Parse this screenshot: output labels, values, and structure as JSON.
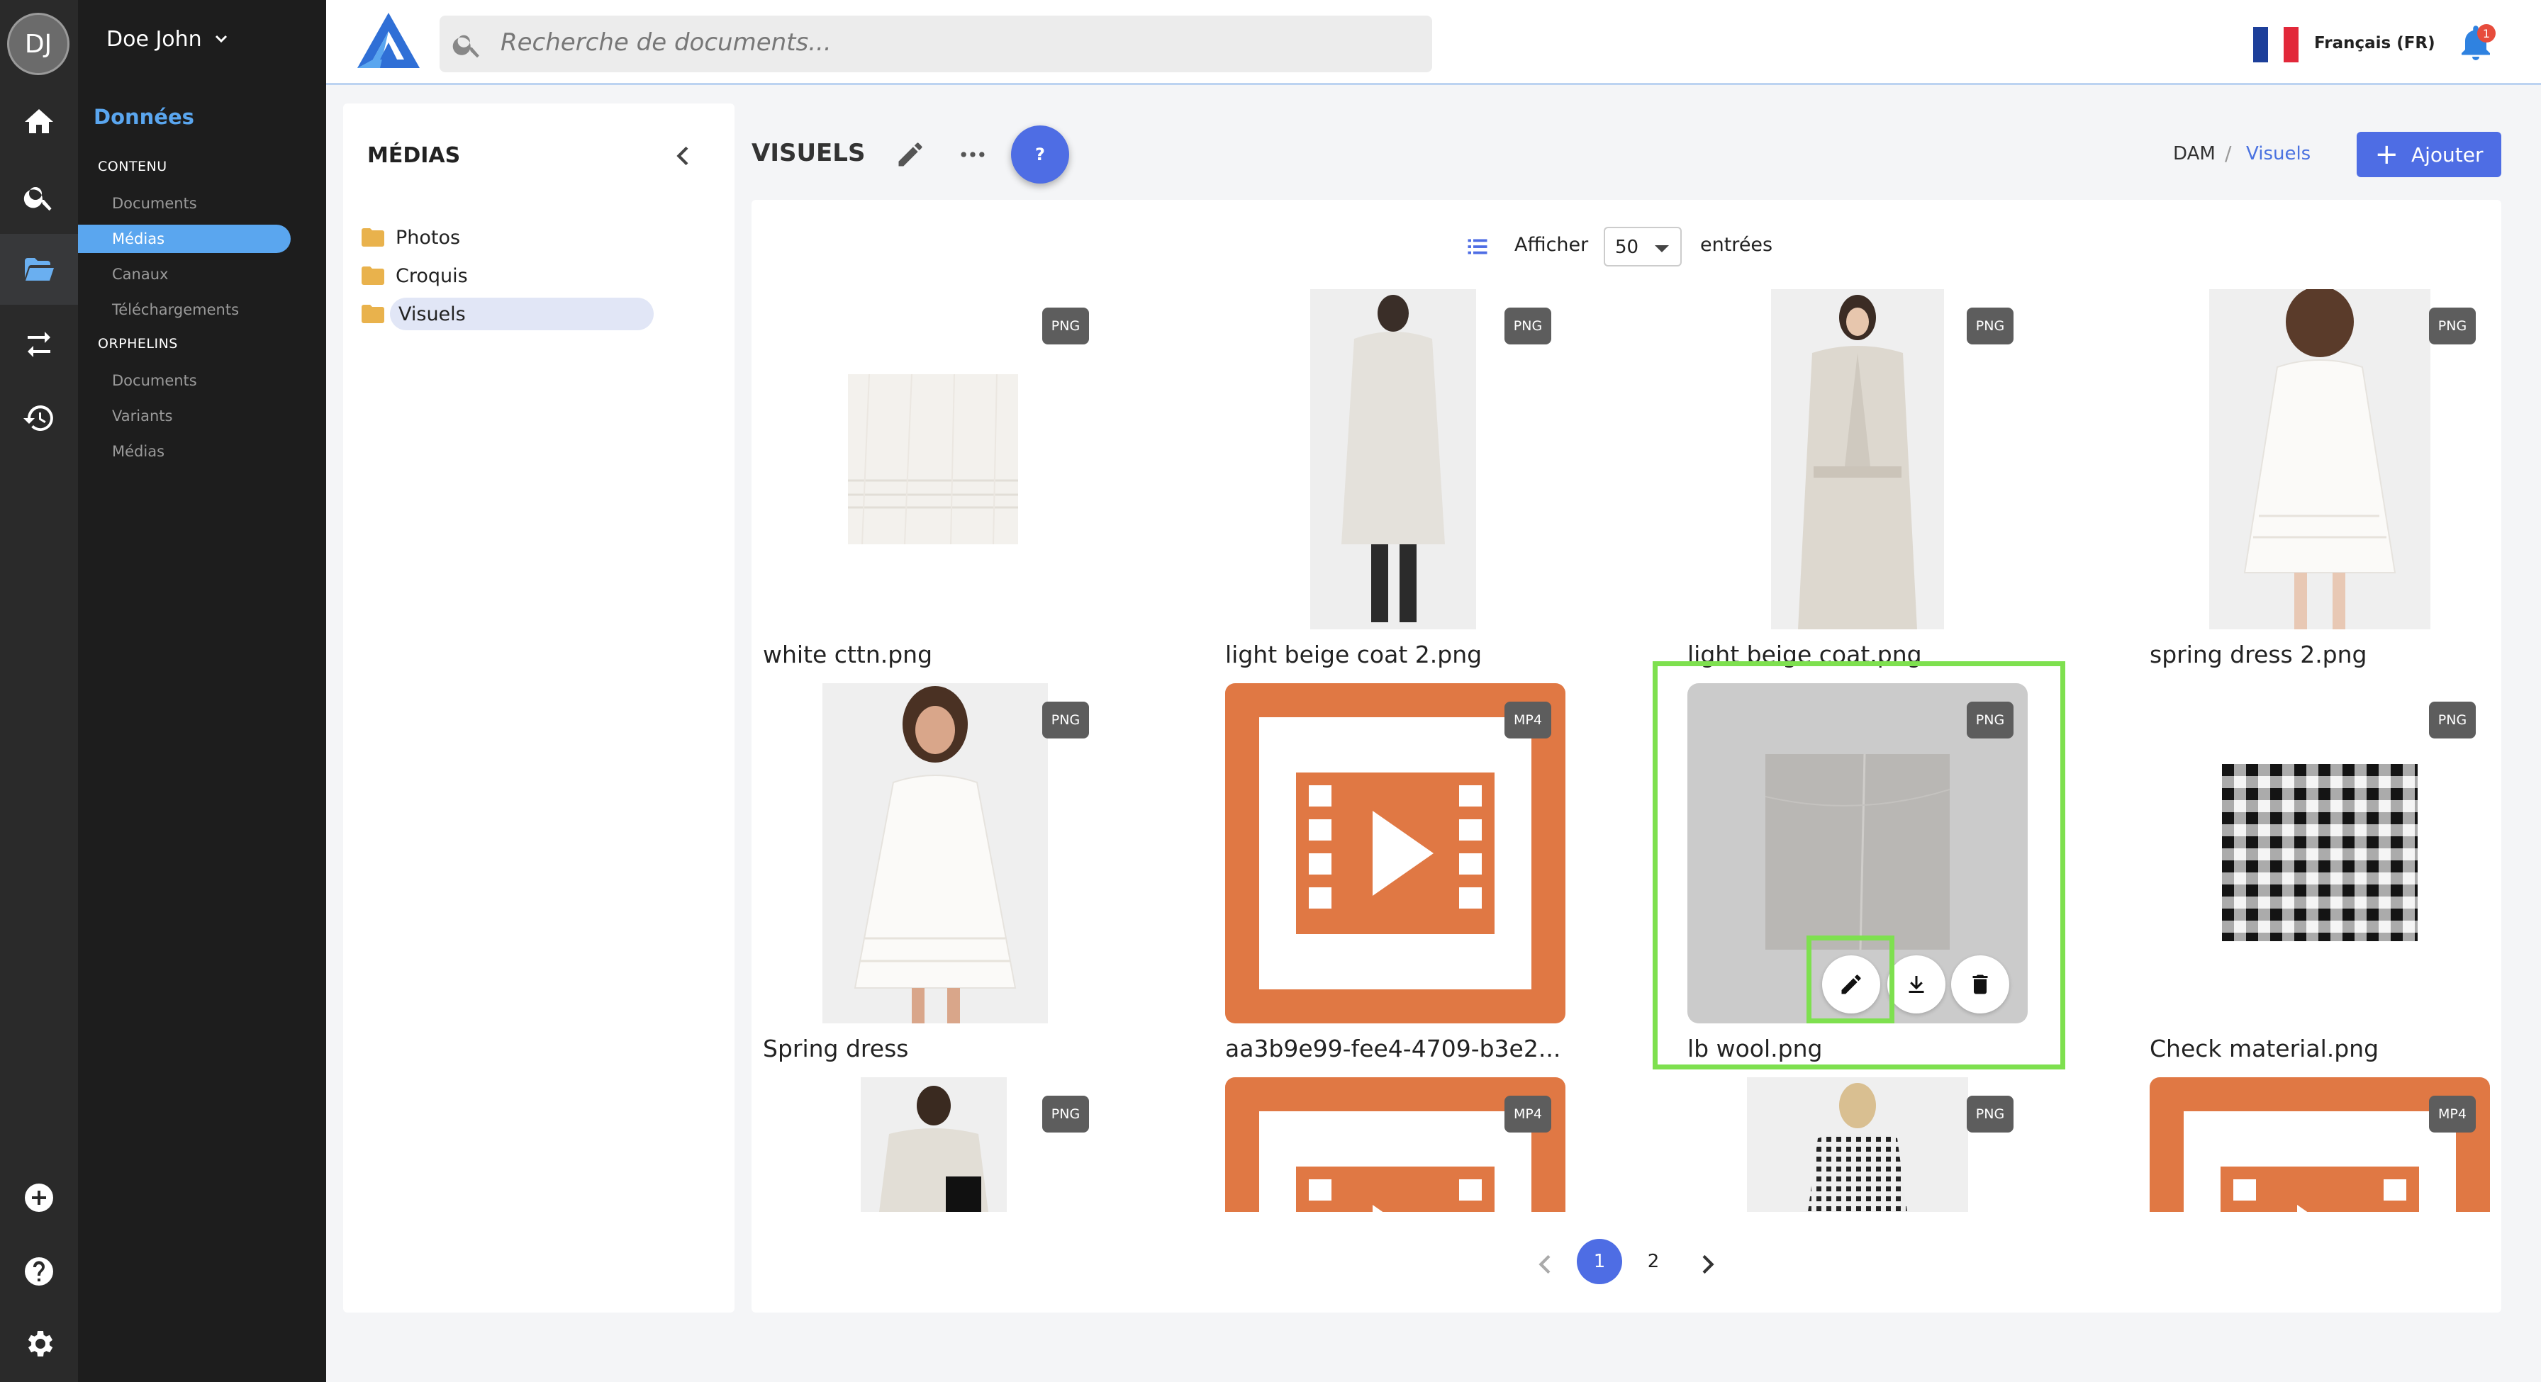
{
  "user": {
    "initials": "DJ",
    "name": "Doe John"
  },
  "nav": {
    "title": "Données",
    "sections": [
      {
        "label": "CONTENU",
        "items": [
          "Documents",
          "Médias",
          "Canaux",
          "Téléchargements"
        ]
      },
      {
        "label": "ORPHELINS",
        "items": [
          "Documents",
          "Variants",
          "Médias"
        ]
      }
    ],
    "selected": "Médias"
  },
  "rail_icons": [
    "home-icon",
    "search-icon",
    "folder-open-icon",
    "transfer-icon",
    "history-icon",
    "add-circle-icon",
    "help-icon",
    "settings-icon"
  ],
  "search": {
    "placeholder": "Recherche de documents..."
  },
  "language": {
    "label": "Français (FR)"
  },
  "notifications": {
    "count": "1"
  },
  "folders_panel": {
    "title": "MÉDIAS",
    "folders": [
      "Photos",
      "Croquis",
      "Visuels"
    ],
    "selected": "Visuels"
  },
  "content": {
    "title": "VISUELS",
    "help_label": "?",
    "breadcrumb": {
      "root": "DAM",
      "separator": "/",
      "current": "Visuels"
    },
    "add_button": "Ajouter",
    "show_label": "Afficher",
    "page_size": "50",
    "entries_label": "entrées"
  },
  "media_items": [
    {
      "name": "white cttn.png",
      "type": "PNG"
    },
    {
      "name": "light beige coat 2.png",
      "type": "PNG"
    },
    {
      "name": "light beige coat.png",
      "type": "PNG"
    },
    {
      "name": "spring dress 2.png",
      "type": "PNG"
    },
    {
      "name": "Spring dress",
      "type": "PNG"
    },
    {
      "name": "aa3b9e99-fee4-4709-b3e2...",
      "type": "MP4"
    },
    {
      "name": "lb wool.png",
      "type": "PNG"
    },
    {
      "name": "Check material.png",
      "type": "PNG"
    },
    {
      "name": "",
      "type": "PNG"
    },
    {
      "name": "",
      "type": "MP4"
    },
    {
      "name": "",
      "type": "PNG"
    },
    {
      "name": "",
      "type": "MP4"
    }
  ],
  "pagination": {
    "pages": [
      "1",
      "2"
    ],
    "current": "1"
  },
  "colors": {
    "accent": "#4e6de4",
    "nav_highlight": "#5aa6ef",
    "video_orange": "#e07844",
    "focus_outline": "#7ee04f"
  }
}
